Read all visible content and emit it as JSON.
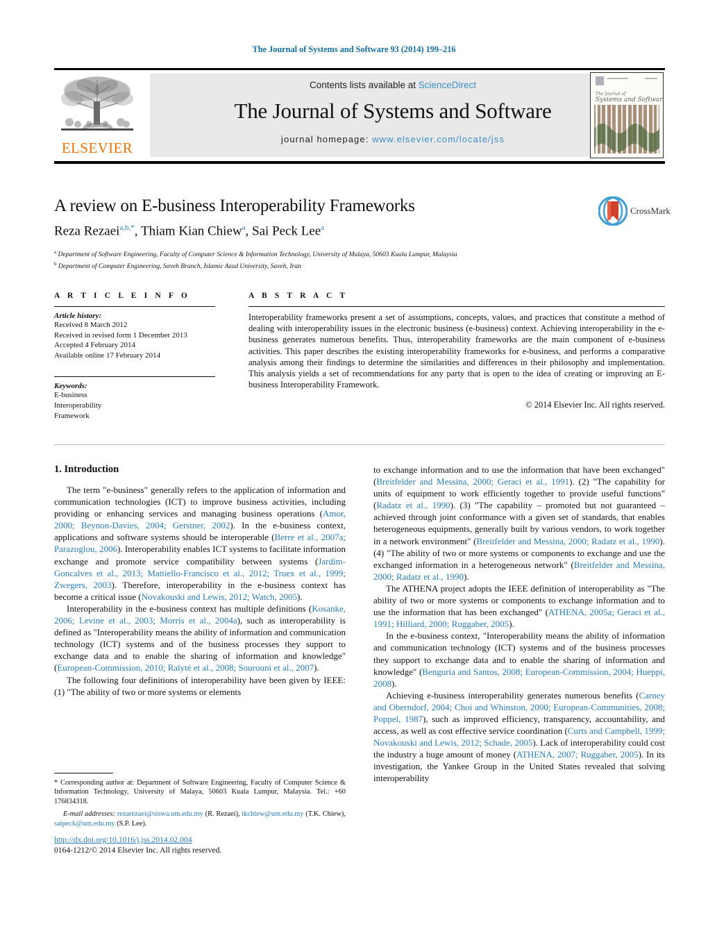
{
  "running_head": "The Journal of Systems and Software 93 (2014) 199–216",
  "masthead": {
    "contents_prefix": "Contents lists available at ",
    "contents_link": "ScienceDirect",
    "journal_title": "The Journal of Systems and Software",
    "homepage_prefix": "journal homepage:",
    "homepage_url": "www.elsevier.com/locate/jss",
    "publisher_wordmark": "ELSEVIER",
    "publisher_color": "#ec7404",
    "link_color": "#3a8fc4",
    "cover_caption_line1": "The Journal of",
    "cover_caption_line2": "Systems and Software"
  },
  "title_block": {
    "title": "A review on E-business Interoperability Frameworks",
    "authors": [
      {
        "name": "Reza Rezaei",
        "sup": "a,b,*"
      },
      {
        "name": "Thiam Kian Chiew",
        "sup": "a"
      },
      {
        "name": "Sai Peck Lee",
        "sup": "a"
      }
    ],
    "affiliations": [
      {
        "marker": "a",
        "text": "Department of Software Engineering, Faculty of Computer Science & Information Technology, University of Malaya, 50603 Kuala Lumpur, Malaysia"
      },
      {
        "marker": "b",
        "text": "Department of Computer Engineering, Saveh Branch, Islamic Azad University, Saveh, Iran"
      }
    ],
    "crossmark_label": "CrossMark"
  },
  "article_info": {
    "heading": "A R T I C L E   I N F O",
    "history_label": "Article history:",
    "history": [
      "Received 8 March 2012",
      "Received in revised form 1 December 2013",
      "Accepted 4 February 2014",
      "Available online 17 February 2014"
    ],
    "keywords_label": "Keywords:",
    "keywords": [
      "E-business",
      "Interoperability",
      "Framework"
    ]
  },
  "abstract": {
    "heading": "A B S T R A C T",
    "text": "Interoperability frameworks present a set of assumptions, concepts, values, and practices that constitute a method of dealing with interoperability issues in the electronic business (e-business) context. Achieving interoperability in the e-business generates numerous benefits. Thus, interoperability frameworks are the main component of e-business activities. This paper describes the existing interoperability frameworks for e-business, and performs a comparative analysis among their findings to determine the similarities and differences in their philosophy and implementation. This analysis yields a set of recommendations for any party that is open to the idea of creating or improving an E-business Interoperability Framework.",
    "copyright": "© 2014 Elsevier Inc. All rights reserved."
  },
  "body": {
    "section_number_title": "1.  Introduction",
    "left_paragraphs": [
      "The term \"e-business\" generally refers to the application of information and communication technologies (ICT) to improve business activities, including providing or enhancing services and managing business operations (Amor, 2000; Beynon-Davies, 2004; Gerstner, 2002). In the e-business context, applications and software systems should be interoperable (Berre et al., 2007a; Parazoglou, 2006). Interoperability enables ICT systems to facilitate information exchange and promote service compatibility between systems (Jardim-Goncalves et al., 2013; Mattiello-Francisco et al., 2012; Truex et al., 1999; Zwegers, 2003). Therefore, interoperability in the e-business context has become a critical issue (Novakouski and Lewis, 2012; Watch, 2005).",
      "Interoperability in the e-business context has multiple definitions (Kosanke, 2006; Levine et al., 2003; Morris et al., 2004a), such as interoperability is defined as \"Interoperability means the ability of information and communication technology (ICT) systems and of the business processes they support to exchange data and to enable the sharing of information and knowledge\" (European-Commission, 2010; Ralyté et al., 2008; Sourouni et al., 2007).",
      "The following four definitions of interoperability have been given by IEEE: (1) \"The ability of two or more systems or elements"
    ],
    "right_paragraphs": [
      "to exchange information and to use the information that have been exchanged\" (Breitfelder and Messina, 2000; Geraci et al., 1991). (2) \"The capability for units of equipment to work efficiently together to provide useful functions\" (Radatz et al., 1990). (3) \"The capability – promoted but not guaranteed – achieved through joint conformance with a given set of standards, that enables heterogeneous equipments, generally built by various vendors, to work together in a network environment\" (Breitfelder and Messina, 2000; Radatz et al., 1990). (4) \"The ability of two or more systems or components to exchange and use the exchanged information in a heterogeneous network\" (Breitfelder and Messina, 2000; Radatz et al., 1990).",
      "The ATHENA project adopts the IEEE definition of interoperability as \"The ability of two or more systems or components to exchange information and to use the information that has been exchanged\" (ATHENA, 2005a; Geraci et al., 1991; Hilliard, 2000; Ruggaber, 2005).",
      "In the e-business context, \"Interoperability means the ability of information and communication technology (ICT) systems and of the business processes they support to exchange data and to enable the sharing of information and knowledge\" (Benguria and Santos, 2008; European-Commission, 2004; Hueppi, 2008).",
      "Achieving e-business interoperability generates numerous benefits (Carney and Oberndorf, 2004; Choi and Whinston, 2000; European-Communities, 2008; Poppel, 1987), such as improved efficiency, transparency, accountability, and access, as well as cost effective service coordination (Curts and Campbell, 1999; Novakouski and Lewis, 2012; Schade, 2005). Lack of interoperability could cost the industry a huge amount of money (ATHENA, 2007; Ruggaber, 2005). In its investigation, the Yankee Group in the United States revealed that solving interoperability"
    ],
    "citation_color": "#2b7cb5"
  },
  "footnotes": {
    "corresponding": "* Corresponding author at: Department of Software Engineering, Faculty of Computer Science & Information Technology, University of Malaya, 50603 Kuala Lumpur, Malaysia. Tel.: +60 176834318.",
    "email_label": "E-mail addresses:",
    "emails": [
      {
        "address": "rezarezaei@siswa.um.edu.my",
        "owner": "(R. Rezaei),"
      },
      {
        "address": "tkchiew@um.edu.my",
        "owner": "(T.K. Chiew),"
      },
      {
        "address": "saipeck@um.edu.my",
        "owner": "(S.P. Lee)."
      }
    ],
    "doi": "http://dx.doi.org/10.1016/j.jss.2014.02.004",
    "issn_line": "0164-1212/© 2014 Elsevier Inc. All rights reserved."
  }
}
